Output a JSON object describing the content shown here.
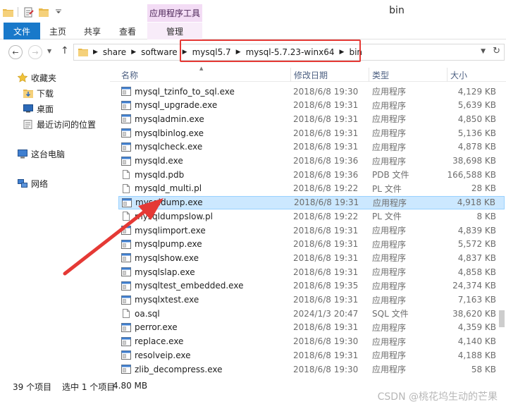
{
  "window": {
    "title": "bin",
    "contextual_tab_group": "应用程序工具"
  },
  "ribbon": {
    "tabs": [
      "文件",
      "主页",
      "共享",
      "查看",
      "管理"
    ]
  },
  "address": {
    "breadcrumbs": [
      "share",
      "software",
      "mysql5.7",
      "mysql-5.7.23-winx64",
      "bin"
    ]
  },
  "nav_pane": {
    "items": [
      {
        "label": "收藏夹",
        "icon": "star-icon"
      },
      {
        "label": "下载",
        "icon": "download-folder-icon"
      },
      {
        "label": "桌面",
        "icon": "desktop-icon"
      },
      {
        "label": "最近访问的位置",
        "icon": "recent-places-icon"
      },
      {
        "label": "这台电脑",
        "icon": "computer-icon"
      },
      {
        "label": "网络",
        "icon": "network-icon"
      }
    ]
  },
  "columns": {
    "name": "名称",
    "date": "修改日期",
    "type": "类型",
    "size": "大小"
  },
  "files": [
    {
      "name": "mysql_tzinfo_to_sql.exe",
      "date": "2018/6/8 19:30",
      "type": "应用程序",
      "size": "4,129 KB",
      "kind": "exe"
    },
    {
      "name": "mysql_upgrade.exe",
      "date": "2018/6/8 19:31",
      "type": "应用程序",
      "size": "5,639 KB",
      "kind": "exe"
    },
    {
      "name": "mysqladmin.exe",
      "date": "2018/6/8 19:31",
      "type": "应用程序",
      "size": "4,850 KB",
      "kind": "exe"
    },
    {
      "name": "mysqlbinlog.exe",
      "date": "2018/6/8 19:31",
      "type": "应用程序",
      "size": "5,136 KB",
      "kind": "exe"
    },
    {
      "name": "mysqlcheck.exe",
      "date": "2018/6/8 19:31",
      "type": "应用程序",
      "size": "4,878 KB",
      "kind": "exe"
    },
    {
      "name": "mysqld.exe",
      "date": "2018/6/8 19:36",
      "type": "应用程序",
      "size": "38,698 KB",
      "kind": "exe"
    },
    {
      "name": "mysqld.pdb",
      "date": "2018/6/8 19:36",
      "type": "PDB 文件",
      "size": "166,588 KB",
      "kind": "doc"
    },
    {
      "name": "mysqld_multi.pl",
      "date": "2018/6/8 19:22",
      "type": "PL 文件",
      "size": "28 KB",
      "kind": "doc"
    },
    {
      "name": "mysqldump.exe",
      "date": "2018/6/8 19:31",
      "type": "应用程序",
      "size": "4,918 KB",
      "kind": "exe",
      "selected": true
    },
    {
      "name": "mysqldumpslow.pl",
      "date": "2018/6/8 19:22",
      "type": "PL 文件",
      "size": "8 KB",
      "kind": "doc"
    },
    {
      "name": "mysqlimport.exe",
      "date": "2018/6/8 19:31",
      "type": "应用程序",
      "size": "4,839 KB",
      "kind": "exe"
    },
    {
      "name": "mysqlpump.exe",
      "date": "2018/6/8 19:31",
      "type": "应用程序",
      "size": "5,572 KB",
      "kind": "exe"
    },
    {
      "name": "mysqlshow.exe",
      "date": "2018/6/8 19:31",
      "type": "应用程序",
      "size": "4,837 KB",
      "kind": "exe"
    },
    {
      "name": "mysqlslap.exe",
      "date": "2018/6/8 19:31",
      "type": "应用程序",
      "size": "4,858 KB",
      "kind": "exe"
    },
    {
      "name": "mysqltest_embedded.exe",
      "date": "2018/6/8 19:35",
      "type": "应用程序",
      "size": "24,374 KB",
      "kind": "exe"
    },
    {
      "name": "mysqlxtest.exe",
      "date": "2018/6/8 19:31",
      "type": "应用程序",
      "size": "7,163 KB",
      "kind": "exe"
    },
    {
      "name": "oa.sql",
      "date": "2024/1/3 20:47",
      "type": "SQL 文件",
      "size": "38,620 KB",
      "kind": "doc"
    },
    {
      "name": "perror.exe",
      "date": "2018/6/8 19:31",
      "type": "应用程序",
      "size": "4,359 KB",
      "kind": "exe"
    },
    {
      "name": "replace.exe",
      "date": "2018/6/8 19:30",
      "type": "应用程序",
      "size": "4,140 KB",
      "kind": "exe"
    },
    {
      "name": "resolveip.exe",
      "date": "2018/6/8 19:31",
      "type": "应用程序",
      "size": "4,188 KB",
      "kind": "exe"
    },
    {
      "name": "zlib_decompress.exe",
      "date": "2018/6/8 19:30",
      "type": "应用程序",
      "size": "58 KB",
      "kind": "exe"
    }
  ],
  "status": {
    "count": "39 个项目",
    "selected": "选中 1 个项目",
    "size": "4.80 MB"
  },
  "watermark": "CSDN @桃花坞生动的芒果",
  "colors": {
    "file_tab": "#1979ca",
    "context_tab": "#f3dcf5",
    "selection": "#cce8ff",
    "annotation_red": "#e53935"
  }
}
